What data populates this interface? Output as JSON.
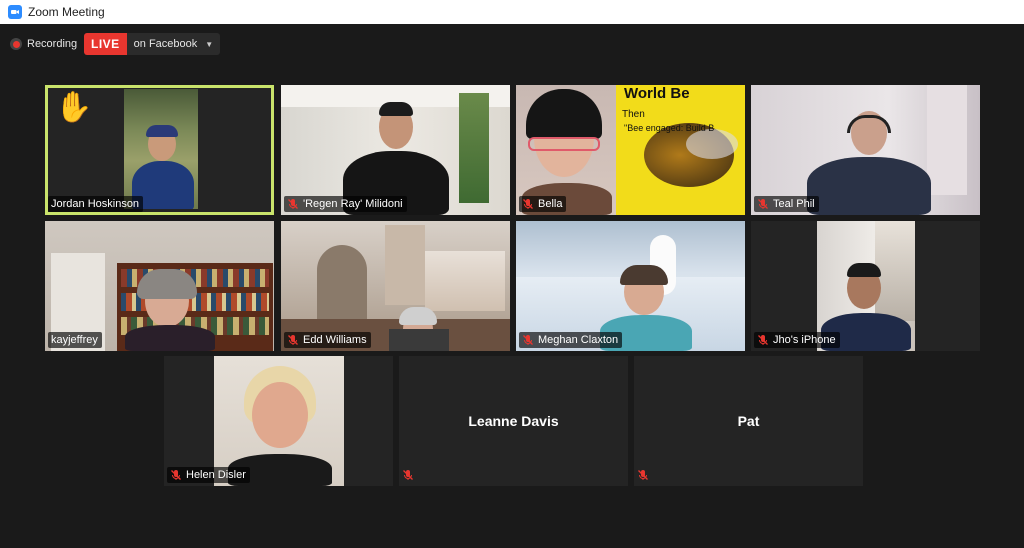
{
  "window": {
    "title": "Zoom Meeting"
  },
  "recording": {
    "label": "Recording"
  },
  "live": {
    "badge": "LIVE",
    "destination": "on Facebook"
  },
  "participants": [
    {
      "name": "Jordan Hoskinson",
      "muted": false,
      "hand_raised": true,
      "active_speaker": true
    },
    {
      "name": "'Regen Ray' Milidoni",
      "muted": true
    },
    {
      "name": "Bella",
      "muted": true,
      "background_text": [
        "World Be",
        "Then",
        "\"Bee engaged: Build B"
      ]
    },
    {
      "name": "Teal Phil",
      "muted": true
    },
    {
      "name": "kayjeffrey",
      "muted": false
    },
    {
      "name": "Edd Williams",
      "muted": true
    },
    {
      "name": "Meghan Claxton",
      "muted": true
    },
    {
      "name": "Jho's iPhone",
      "muted": true
    },
    {
      "name": "Helen Disler",
      "muted": true
    },
    {
      "name": "Leanne Davis",
      "muted": true,
      "video_off": true
    },
    {
      "name": "Pat",
      "muted": true,
      "video_off": true
    }
  ],
  "colors": {
    "live_red": "#e8362f",
    "active_outline": "#c9e36b",
    "zoom_blue": "#2d8cff"
  },
  "icons": {
    "hand": "raised-hand-icon",
    "mute": "muted-mic-icon"
  }
}
